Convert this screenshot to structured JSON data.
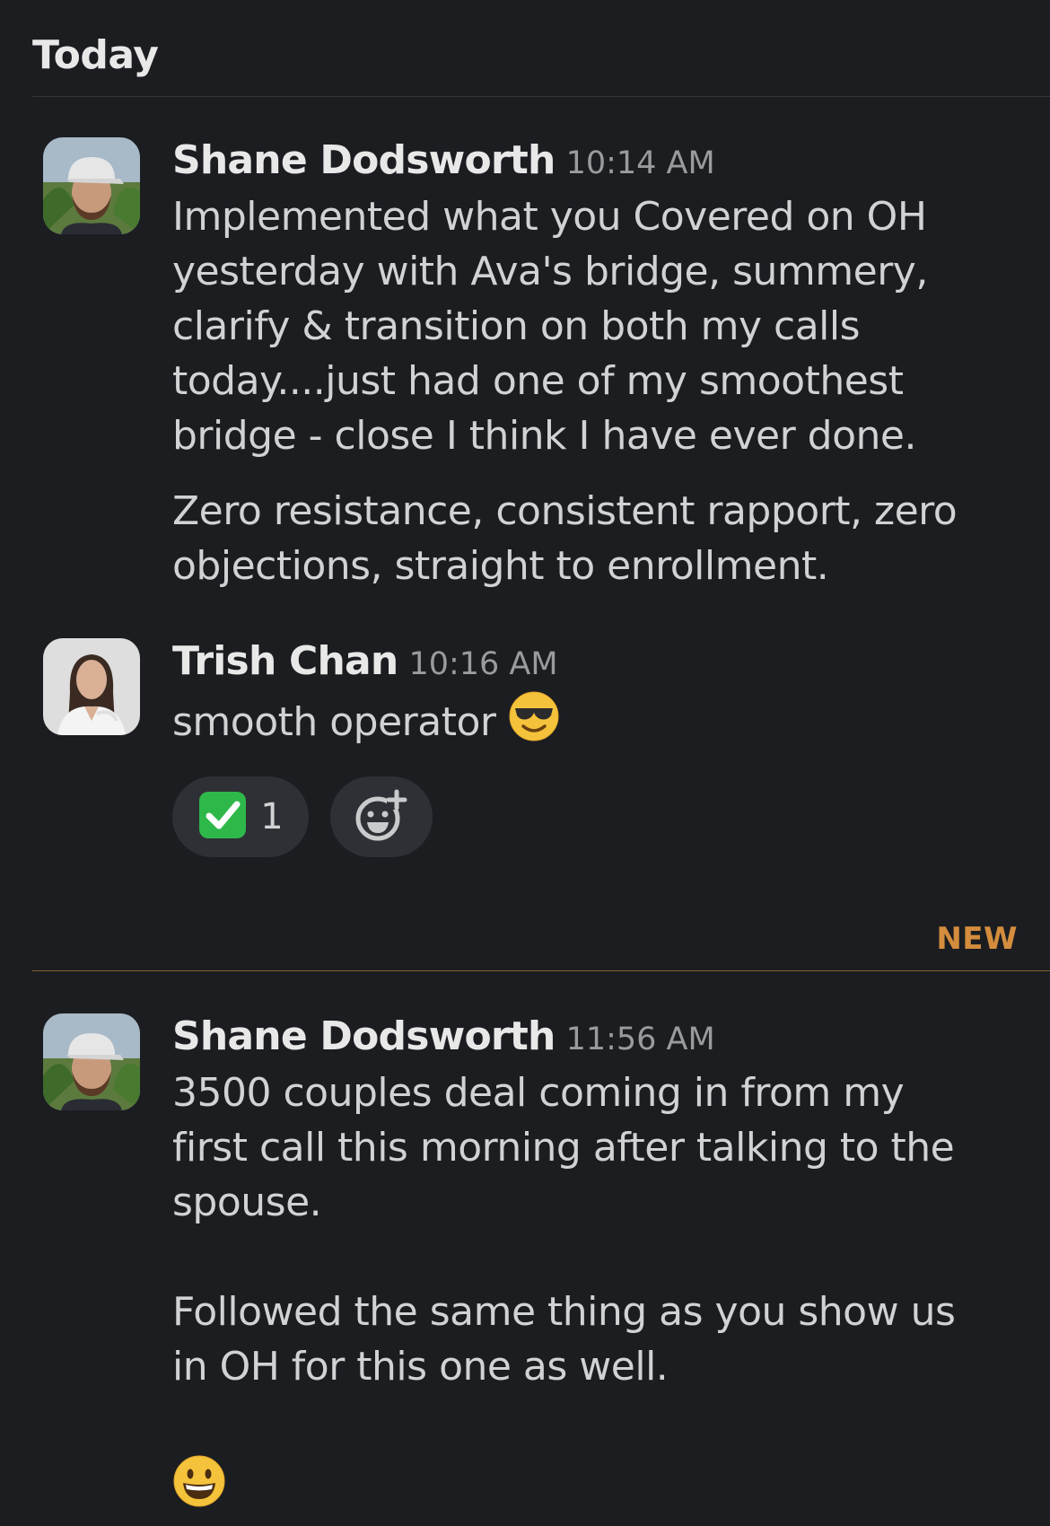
{
  "day_header": "Today",
  "new_divider_label": "NEW",
  "messages": [
    {
      "author": "Shane Dodsworth",
      "time": "10:14 AM",
      "paragraphs": [
        [
          "Implemented what you Covered on OH",
          "yesterday with Ava's bridge, summery,",
          "clarify & transition on both my calls",
          "today....just had one of my smoothest",
          "bridge - close I think I have ever done."
        ],
        [
          "Zero resistance, consistent rapport, zero",
          "objections, straight to enrollment."
        ]
      ]
    },
    {
      "author": "Trish Chan",
      "time": "10:16 AM",
      "text": "smooth operator",
      "emoji": "smiling-face-with-sunglasses",
      "reactions": [
        {
          "emoji": "white-check-mark",
          "count": "1"
        }
      ],
      "add_reaction_icon": "add-reaction-icon"
    },
    {
      "author": "Shane Dodsworth",
      "time": "11:56 AM",
      "paragraphs": [
        [
          "3500 couples deal coming in from my",
          "first call this morning after talking to the",
          "spouse."
        ],
        [
          "Followed the same thing as you show us",
          "in OH for this one as well."
        ]
      ],
      "trailing_emoji": "grinning-face"
    }
  ]
}
